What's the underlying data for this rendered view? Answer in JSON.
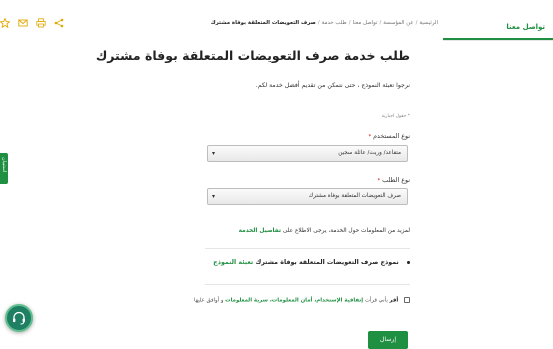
{
  "breadcrumb": {
    "home": "الرئيسية",
    "section": "عن المؤسسة",
    "contact": "تواصل معنا",
    "request": "طلب خدمة",
    "current": "صرف التعويضات المتعلقة بوفاة مشترك"
  },
  "sidebar": {
    "contact_us": "تواصل معنا"
  },
  "share_icons": [
    "star-icon",
    "email-icon",
    "print-icon",
    "share-icon"
  ],
  "page": {
    "title": "طلب خدمة   صرف التعويضات المتعلقة بوفاة مشترك",
    "intro": "نرجوا تعبئة النموذج ، حتى نتمكن من تقديم أفضل خدمة لكم."
  },
  "form": {
    "required_note": "* حقول اجبارية",
    "user_type": {
      "label": "نوع المستخدم",
      "required_mark": "*",
      "value": "متقاعد/ وريث/ عائلة سجين"
    },
    "request_type": {
      "label": "نوع الطلب",
      "required_mark": "*",
      "value": "صرف التعويضات المتعلقة بوفاة مشترك"
    },
    "more_info": {
      "text": "لمزيد من المعلومات حول الخدمة، يرجى الاطلاع على",
      "link": "تفاصيل الخدمة"
    },
    "model_item": {
      "text": "نموذج صرف التعويضات المتعلقة بوفاة مشترك",
      "link": "تعبئة النموذج"
    },
    "agreement": {
      "prefix": "أقر",
      "middle": "بأني قرأت",
      "terms": "إتفاقية الإستخدام، أمان المعلومات، سرية المعلومات",
      "suffix": "و أوافق عليها"
    },
    "submit_label": "إرسال"
  },
  "left_tab": {
    "label": "استبيان"
  },
  "colors": {
    "accent": "#1f8f42",
    "chat": "#1f7f63"
  }
}
